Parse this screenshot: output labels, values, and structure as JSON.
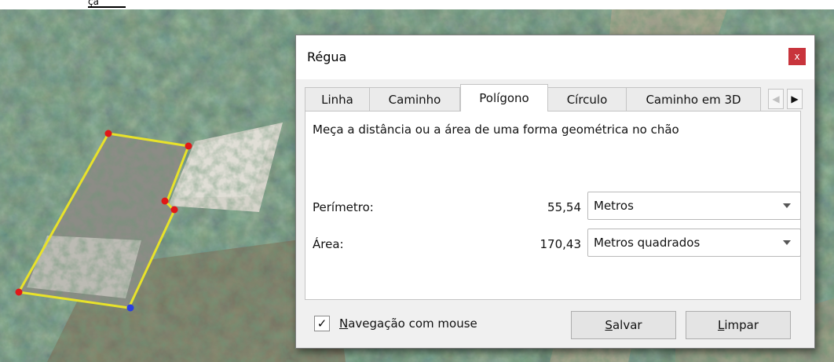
{
  "header_fragment": "ça",
  "dialog": {
    "title": "Régua",
    "close_label": "x",
    "tabs": [
      {
        "label": "Linha"
      },
      {
        "label": "Caminho"
      },
      {
        "label": "Polígono",
        "active": true
      },
      {
        "label": "Círculo"
      },
      {
        "label": "Caminho em 3D"
      }
    ],
    "tab_scroll_left": "◀",
    "tab_scroll_right": "▶",
    "description": "Meça a distância ou a área de uma forma geométrica no chão",
    "perimeter": {
      "label": "Perímetro:",
      "value": "55,54",
      "unit": "Metros"
    },
    "area": {
      "label": "Área:",
      "value": "170,43",
      "unit": "Metros quadrados"
    },
    "mouse_nav": {
      "label_first": "N",
      "label_rest": "avegação com mouse",
      "checked": true,
      "check_glyph": "✓"
    },
    "save_button": {
      "first": "S",
      "rest": "alvar"
    },
    "clear_button": {
      "first": "L",
      "rest": "impar"
    }
  },
  "colors": {
    "polygon_stroke": "#e8e22a",
    "vertex": "#e01818",
    "vertex_active": "#2a3fe0",
    "close_button": "#c8343c"
  }
}
